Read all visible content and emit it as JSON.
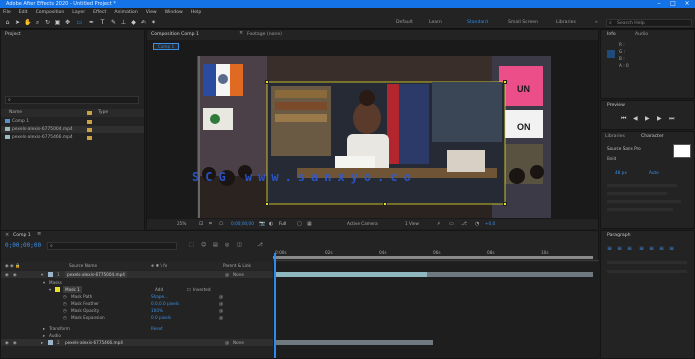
{
  "window": {
    "title": "Adobe After Effects 2020 - Untitled Project *"
  },
  "menu": [
    "File",
    "Edit",
    "Composition",
    "Layer",
    "Effect",
    "Animation",
    "View",
    "Window",
    "Help"
  ],
  "workspaces": {
    "items": [
      "Default",
      "Learn",
      "Standard",
      "Small Screen",
      "Libraries"
    ],
    "active": "Standard",
    "more": "»",
    "search": "Search Help"
  },
  "project": {
    "title": "Project",
    "search_glyph": "⌕",
    "columns": [
      "Name",
      "Type"
    ],
    "items": [
      {
        "name": "Comp 1"
      },
      {
        "name": "pexels-alexis-6775004.mp4"
      },
      {
        "name": "pexels-alexis-6775466.mp4"
      }
    ],
    "footer": "8 bpc"
  },
  "composition": {
    "tab": "Composition Comp 1",
    "footage_tab": "Footage (none)",
    "comp_chip": "Comp 1",
    "zoom": "25%",
    "timecode": "0;00;00;00",
    "resolution": "Full",
    "camera": "Active Camera",
    "views": "1 View",
    "exposure": "+0.0",
    "photo_sign_text_1": "UN",
    "photo_sign_text_2": "ON",
    "watermark": "SCG www.sanxyo.co"
  },
  "info_panel": {
    "tab": "Info",
    "tab2": "Audio",
    "lines": [
      "R :",
      "G :",
      "B :",
      "A : 0"
    ]
  },
  "preview": {
    "title": "Preview"
  },
  "libraries": {
    "tab": "Libraries",
    "char_tab": "Character",
    "font": "Source Sans Pro",
    "style": "Bold",
    "size": "48 px",
    "leading": "Auto"
  },
  "paragraph": {
    "title": "Paragraph"
  },
  "timeline": {
    "tab": "Comp 1",
    "timecode": "0;00;00;00",
    "search_glyph": "⌕",
    "ruler": [
      "0:00s",
      "02s",
      "04s",
      "06s",
      "08s",
      "10s"
    ],
    "layers": [
      {
        "num": "1",
        "name": "pexels-alexis-6775004.mp4",
        "parent": "None"
      },
      {
        "num": "2",
        "name": "pexels-alexis-6775466.mp4",
        "parent": "None"
      }
    ],
    "mode_label": "Add",
    "mode_value": "Inverted",
    "mask_group": "Masks",
    "mask_name": "Mask 1",
    "mask_props": [
      {
        "name": "Mask Path",
        "value": "Shape..."
      },
      {
        "name": "Mask Feather",
        "value": "0.0,0.0 pixels"
      },
      {
        "name": "Mask Opacity",
        "value": "100%"
      },
      {
        "name": "Mask Expansion",
        "value": "0.0 pixels"
      }
    ],
    "transform": "Transform",
    "audio": "Audio",
    "reset": "Reset"
  },
  "colors": {
    "accent": "#2d8ceb",
    "titlebar": "#1473e6",
    "playhead": "#2d8ceb",
    "bar_cyan": "#8fb7c0",
    "bar_grey": "#6f7a80"
  }
}
